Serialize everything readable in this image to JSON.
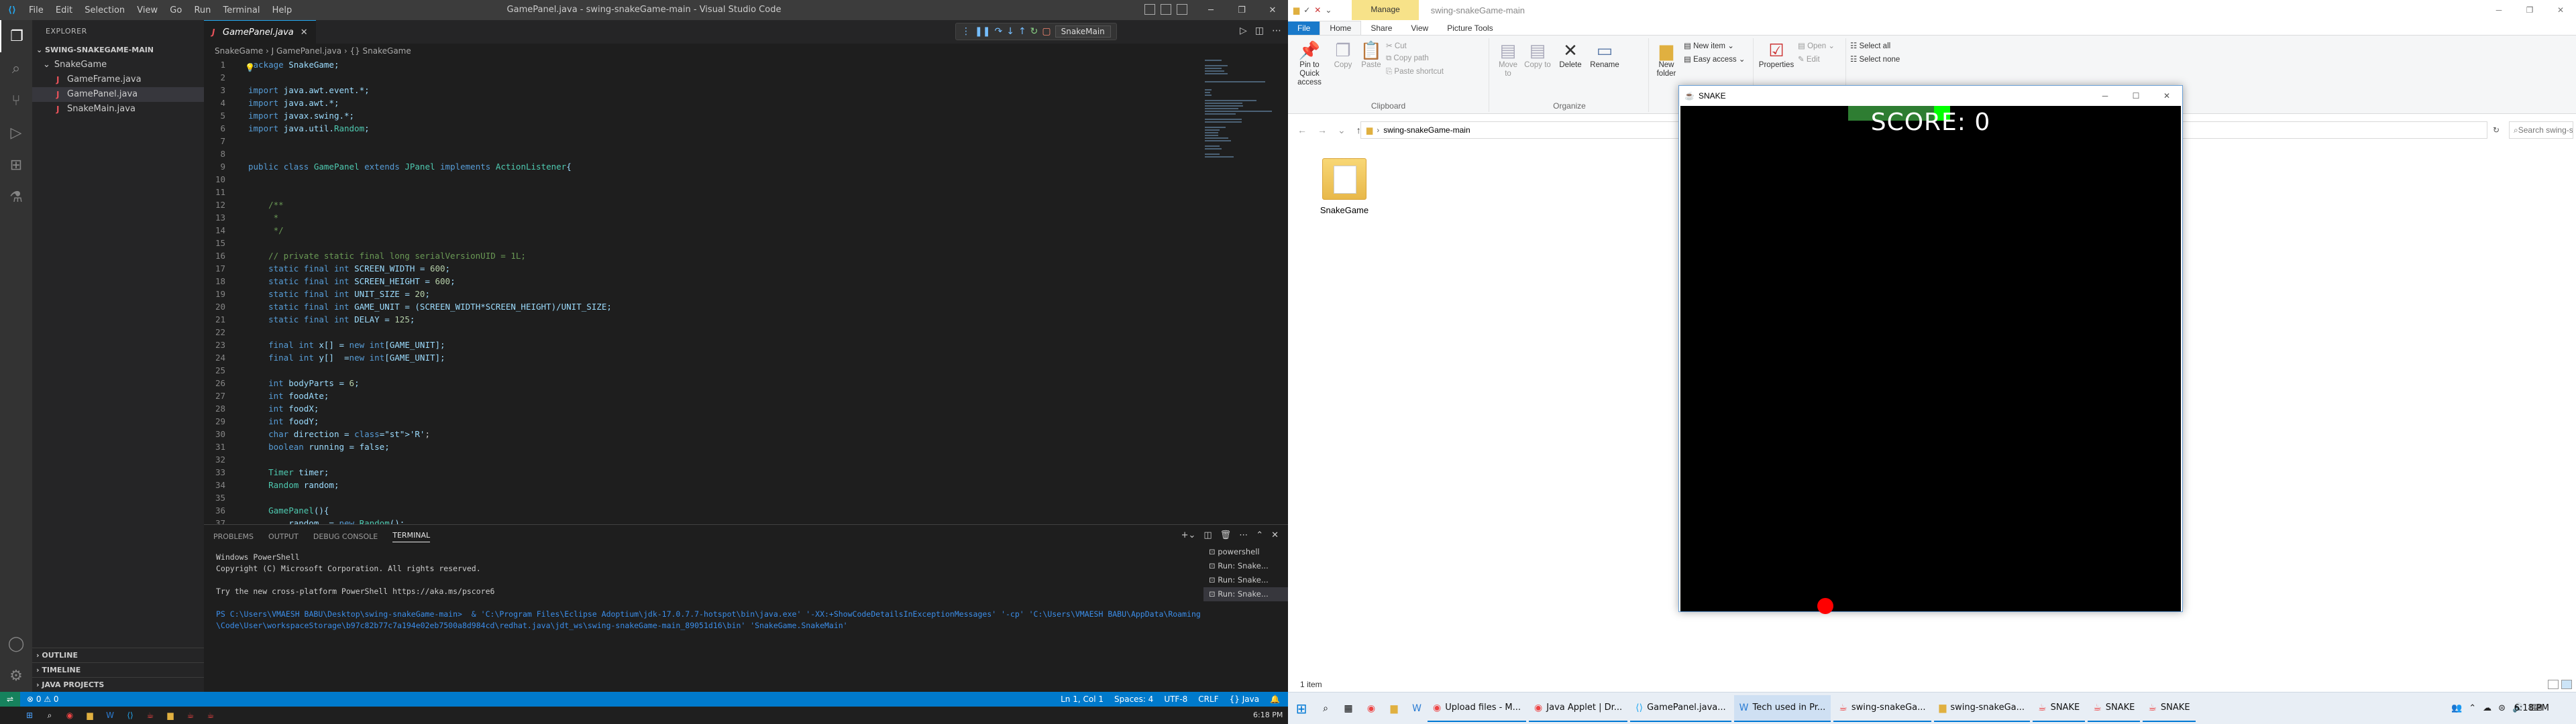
{
  "vscode": {
    "window_title": "GamePanel.java - swing-snakeGame-main - Visual Studio Code",
    "menu": [
      "File",
      "Edit",
      "Selection",
      "View",
      "Go",
      "Run",
      "Terminal",
      "Help"
    ],
    "explorer_header": "EXPLORER",
    "project": "SWING-SNAKEGAME-MAIN",
    "folder": "SnakeGame",
    "files": [
      "GameFrame.java",
      "GamePanel.java",
      "SnakeMain.java"
    ],
    "bottom_sections": [
      "OUTLINE",
      "TIMELINE",
      "JAVA PROJECTS"
    ],
    "tab_label": "GamePanel.java",
    "run_config": "SnakeMain",
    "breadcrumb": "SnakeGame  ›  J GamePanel.java  ›  {} SnakeGame",
    "code_lines": [
      "package SnakeGame;",
      "",
      "import java.awt.event.*;",
      "import java.awt.*;",
      "import javax.swing.*;",
      "import java.util.Random;",
      "",
      "",
      "public class GamePanel extends JPanel implements ActionListener{",
      "",
      "",
      "    /**",
      "     *",
      "     */",
      "",
      "    // private static final long serialVersionUID = 1L;",
      "    static final int SCREEN_WIDTH = 600;",
      "    static final int SCREEN_HEIGHT = 600;",
      "    static final int UNIT_SIZE = 20;",
      "    static final int GAME_UNIT = (SCREEN_WIDTH*SCREEN_HEIGHT)/UNIT_SIZE;",
      "    static final int DELAY = 125;",
      "",
      "    final int x[] = new int[GAME_UNIT];",
      "    final int y[]  =new int[GAME_UNIT];",
      "",
      "    int bodyParts = 6;",
      "    int foodAte;",
      "    int foodX;",
      "    int foodY;",
      "    char direction = 'R';",
      "    boolean running = false;",
      "",
      "    Timer timer;",
      "    Random random;",
      "",
      "    GamePanel(){",
      "        random  = new Random();"
    ],
    "panel_tabs": [
      "PROBLEMS",
      "OUTPUT",
      "DEBUG CONSOLE",
      "TERMINAL"
    ],
    "terminal_lines": [
      "Windows PowerShell",
      "Copyright (C) Microsoft Corporation. All rights reserved.",
      "",
      "Try the new cross-platform PowerShell https://aka.ms/pscore6",
      "",
      "PS C:\\Users\\VMAESH BABU\\Desktop\\swing-snakeGame-main>  & 'C:\\Program Files\\Eclipse Adoptium\\jdk-17.0.7.7-hotspot\\bin\\java.exe' '-XX:+ShowCodeDetailsInExceptionMessages' '-cp' 'C:\\Users\\VMAESH BABU\\AppData\\Roaming\\Code\\User\\workspaceStorage\\b97c82b77c7a194e02eb7500a8d984cd\\redhat.java\\jdt_ws\\swing-snakeGame-main_89051d16\\bin' 'SnakeGame.SnakeMain'"
    ],
    "terminal_list": [
      "powershell",
      "Run: Snake...",
      "Run: Snake...",
      "Run: Snake..."
    ],
    "status_left": "⊗ 0 ⚠ 0",
    "status_right": [
      "Ln 1, Col 1",
      "Spaces: 4",
      "UTF-8",
      "CRLF",
      "{} Java"
    ],
    "time": "6:18 PM"
  },
  "explorer": {
    "manage_tab": "Manage",
    "title": "swing-snakeGame-main",
    "ribbon_tabs": [
      "File",
      "Home",
      "Share",
      "View",
      "Picture Tools"
    ],
    "clipboard": {
      "pin": "Pin to Quick access",
      "copy": "Copy",
      "paste": "Paste",
      "cut": "Cut",
      "copy_path": "Copy path",
      "paste_shortcut": "Paste shortcut",
      "label": "Clipboard"
    },
    "organize": {
      "move_to": "Move to",
      "copy_to": "Copy to",
      "delete": "Delete",
      "rename": "Rename",
      "label": "Organize"
    },
    "new": {
      "new_folder": "New folder",
      "new_item": "New item",
      "easy_access": "Easy access"
    },
    "open": {
      "properties": "Properties",
      "open": "Open",
      "edit": "Edit"
    },
    "select": {
      "select_all": "Select all",
      "select_none": "Select none"
    },
    "address": "swing-snakeGame-main",
    "search_placeholder": "Search swing-snak...",
    "folder_name": "SnakeGame",
    "item_count": "1 item"
  },
  "snake": {
    "title": "SNAKE",
    "score": "SCORE: 0"
  },
  "taskbar": {
    "apps": [
      {
        "label": "Upload files - M...",
        "icon": "browser-icon"
      },
      {
        "label": "Java Applet | Dr...",
        "icon": "browser-icon"
      },
      {
        "label": "GamePanel.java...",
        "icon": "vscode-icon"
      },
      {
        "label": "Tech used in Pr...",
        "icon": "word-icon"
      },
      {
        "label": "swing-snakeGa...",
        "icon": "java-icon"
      },
      {
        "label": "swing-snakeGa...",
        "icon": "folder-icon"
      },
      {
        "label": "SNAKE",
        "icon": "java-icon"
      },
      {
        "label": "SNAKE",
        "icon": "java-icon"
      },
      {
        "label": "SNAKE",
        "icon": "java-icon"
      }
    ],
    "time": "6:18 PM"
  }
}
